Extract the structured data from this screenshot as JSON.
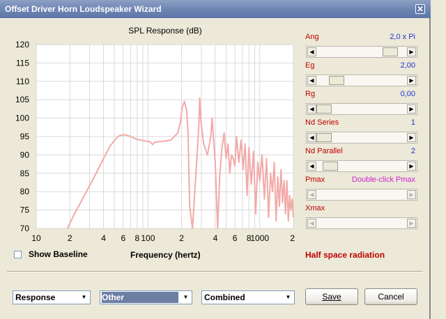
{
  "window": {
    "title": "Offset Driver Horn Loudspeaker Wizard",
    "close_glyph": "✕"
  },
  "chart_data": {
    "type": "line",
    "title": "SPL Response (dB)",
    "xlabel": "Frequency (hertz)",
    "ylabel": "",
    "x_scale": "log",
    "xlim": [
      10,
      2000
    ],
    "ylim": [
      70,
      120
    ],
    "grid": true,
    "x_ticks": [
      {
        "value": 10,
        "label": "10"
      },
      {
        "value": 20,
        "label": "2"
      },
      {
        "value": 40,
        "label": "4"
      },
      {
        "value": 60,
        "label": "6"
      },
      {
        "value": 80,
        "label": "8"
      },
      {
        "value": 100,
        "label": "100"
      },
      {
        "value": 200,
        "label": "2"
      },
      {
        "value": 400,
        "label": "4"
      },
      {
        "value": 600,
        "label": "6"
      },
      {
        "value": 800,
        "label": "8"
      },
      {
        "value": 1000,
        "label": "1000"
      },
      {
        "value": 2000,
        "label": "2"
      }
    ],
    "y_ticks": [
      70,
      75,
      80,
      85,
      90,
      95,
      100,
      105,
      110,
      115,
      120
    ],
    "series": [
      {
        "color": "#f2aaa8",
        "x": [
          19,
          22,
          27,
          33,
          40,
          46,
          52,
          56,
          62,
          70,
          80,
          95,
          105,
          110,
          115,
          130,
          160,
          185,
          195,
          203,
          212,
          222,
          228,
          232,
          236,
          250,
          265,
          278,
          285,
          290,
          298,
          315,
          340,
          365,
          375,
          385,
          400,
          420,
          440,
          460,
          480,
          500,
          520,
          540,
          560,
          580,
          600,
          620,
          650,
          680,
          710,
          740,
          770,
          800,
          840,
          880,
          920,
          960,
          1000,
          1050,
          1100,
          1150,
          1200,
          1250,
          1300,
          1350,
          1400,
          1450,
          1500,
          1550,
          1600,
          1650,
          1700,
          1750,
          1800,
          1850,
          1900,
          1950,
          2000
        ],
        "y": [
          70,
          74,
          79,
          84,
          89,
          92.5,
          94.5,
          95.3,
          95.5,
          95,
          94.2,
          93.8,
          93.5,
          92.8,
          93.5,
          93.6,
          94,
          96,
          99,
          103,
          104.5,
          102,
          96,
          86,
          76,
          66,
          82,
          92.5,
          98,
          105.5,
          99,
          93,
          90,
          95,
          100,
          95,
          88,
          66,
          85,
          92,
          96,
          89,
          93,
          85,
          90,
          89,
          87,
          95,
          88,
          94,
          86,
          93,
          79,
          92,
          82,
          91,
          74,
          88,
          83,
          90,
          78,
          89,
          73,
          85,
          80,
          88,
          72,
          84,
          76,
          86,
          77,
          83,
          74,
          83,
          72,
          79,
          75,
          78,
          73
        ]
      }
    ]
  },
  "sliders": [
    {
      "label": "Ang",
      "value": "2,0 x Pi",
      "level": 0.88,
      "disabled": false,
      "value_color": "#2030d0"
    },
    {
      "label": "Eg",
      "value": "2,00",
      "level": 0.17,
      "disabled": false,
      "value_color": "#2030d0"
    },
    {
      "label": "Rg",
      "value": "0,00",
      "level": 0.0,
      "disabled": false,
      "value_color": "#2030d0"
    },
    {
      "label": "Nd  Series",
      "value": "1",
      "level": 0.0,
      "disabled": false,
      "value_color": "#2030d0"
    },
    {
      "label": "Nd  Parallel",
      "value": "2",
      "level": 0.08,
      "disabled": false,
      "value_color": "#2030d0"
    },
    {
      "label": "Pmax",
      "value": "Double-click Pmax",
      "level": null,
      "disabled": true,
      "value_color": "#cc22cc"
    },
    {
      "label": "Xmax",
      "value": "",
      "level": null,
      "disabled": true,
      "value_color": "#2030d0"
    }
  ],
  "show_baseline": {
    "label": "Show Baseline",
    "checked": false
  },
  "half_space_label": "Half space radiation",
  "bottom": {
    "combo1": "Response",
    "combo2": "Other",
    "combo3": "Combined",
    "save_label": "Save",
    "cancel_label": "Cancel",
    "arrow_glyph": "▼"
  },
  "icons": {
    "left_arrow": "◀",
    "right_arrow": "▶"
  }
}
